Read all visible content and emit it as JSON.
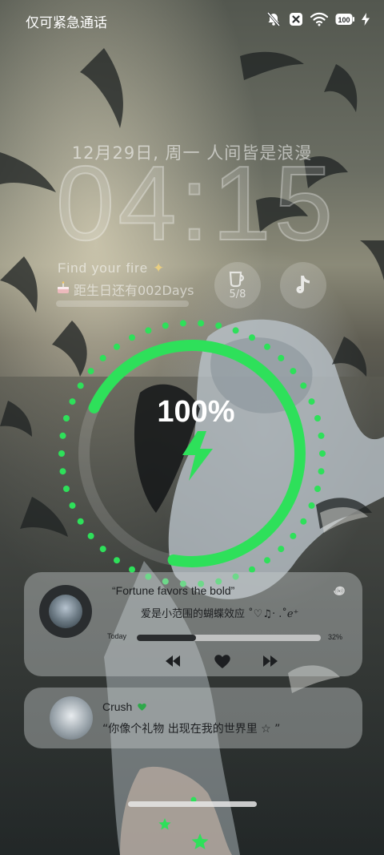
{
  "status_bar": {
    "carrier_text": "仅可紧急通话",
    "icons": [
      "mute-bell-icon",
      "no-sim-icon",
      "wifi-icon",
      "battery-icon",
      "charging-bolt-icon"
    ],
    "battery_level": "100"
  },
  "lockscreen": {
    "date_line": "12月29日, 周一 人间皆是浪漫",
    "time": "04:15",
    "slogan": "Find your fire",
    "birthday_text": "距生日还有002Days"
  },
  "widgets": {
    "cup_count": "5/8",
    "tiktok_icon": "tiktok-icon"
  },
  "charging": {
    "percent_label": "100%",
    "percent_value": 100,
    "accent_color": "#2ee05a"
  },
  "music": {
    "quote": "“Fortune favors the bold”",
    "song_title": "爱是小范围的蝴蝶效应 ˚♡♫· .˚ℯ⁺",
    "today_label": "Today",
    "progress_label": "32%",
    "progress_value": 0.32,
    "controls": [
      "previous-icon",
      "heart-icon",
      "next-icon"
    ]
  },
  "message": {
    "name": "Crush",
    "text": "“你像个礼物 出现在我的世界里 ☆ ”"
  }
}
